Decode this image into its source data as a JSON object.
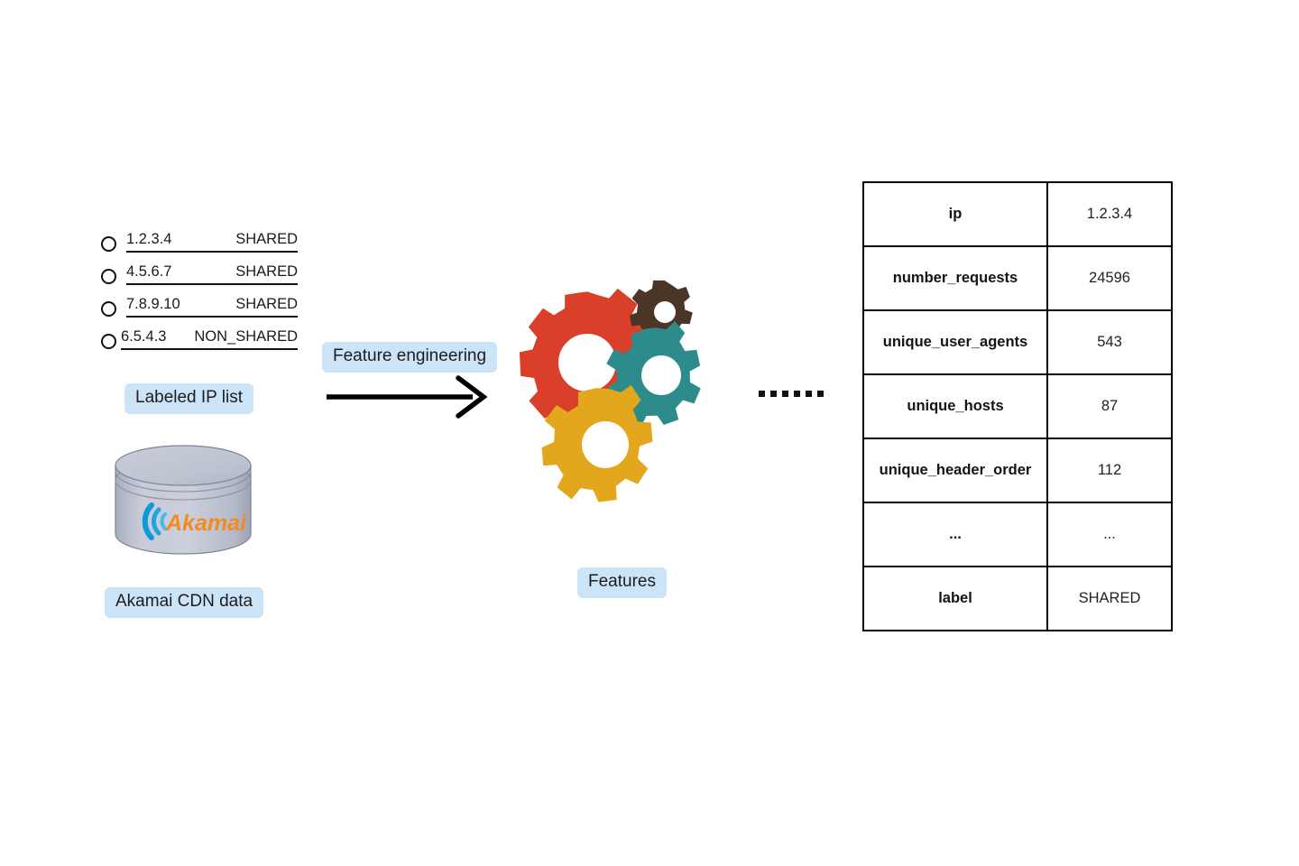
{
  "diagram": {
    "title": "Feature engineering pipeline from labeled IP list and Akamai CDN data to feature table",
    "accent_highlight_color": "#cce4f7"
  },
  "ip_list": {
    "pill_label": "Labeled IP list",
    "rows": [
      {
        "ip": "1.2.3.4",
        "label": "SHARED"
      },
      {
        "ip": "4.5.6.7",
        "label": "SHARED"
      },
      {
        "ip": "7.8.9.10",
        "label": "SHARED"
      },
      {
        "ip": "6.5.4.3",
        "label": "NON_SHARED"
      }
    ]
  },
  "cdn": {
    "pill_label": "Akamai CDN data",
    "logo_text": "Akamai",
    "logo_text_color": "#f28b21",
    "logo_wave_color": "#0d9bd7",
    "cylinder_color": "#c2c6d4"
  },
  "transform": {
    "pill_label": "Feature engineering",
    "arrow_icon": "right-arrow-icon"
  },
  "gears": {
    "pill_label": "Features",
    "items": [
      {
        "name": "red-gear",
        "color": "#d93f29"
      },
      {
        "name": "brown-gear",
        "color": "#4b3527"
      },
      {
        "name": "teal-gear",
        "color": "#2e8b8b"
      },
      {
        "name": "yellow-gear",
        "color": "#e3a71d"
      }
    ]
  },
  "ellipsis": {
    "dot_count": 6
  },
  "feature_table": {
    "rows": [
      {
        "key": "ip",
        "value": "1.2.3.4"
      },
      {
        "key": "number_requests",
        "value": "24596"
      },
      {
        "key": "unique_user_agents",
        "value": "543"
      },
      {
        "key": "unique_hosts",
        "value": "87"
      },
      {
        "key": "unique_header_order",
        "value": "112"
      },
      {
        "key": "...",
        "value": "..."
      },
      {
        "key": "label",
        "value": "SHARED"
      }
    ]
  }
}
